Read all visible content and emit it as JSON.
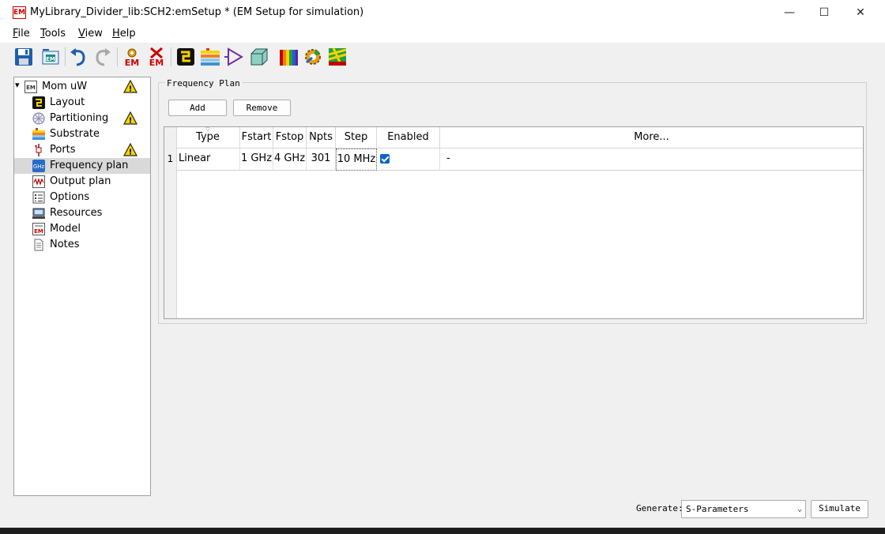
{
  "window": {
    "title": "MyLibrary_Divider_lib:SCH2:emSetup * (EM Setup for simulation)",
    "app_icon_text": "EM",
    "minimize_glyph": "—",
    "maximize_glyph": "☐",
    "close_glyph": "✕"
  },
  "menu": [
    "File",
    "Tools",
    "View",
    "Help"
  ],
  "toolbar": {
    "icons": [
      "save-icon",
      "export-em-icon",
      "undo-icon",
      "redo-icon",
      "em-settings-icon",
      "em-delete-icon",
      "layout-icon",
      "substrate-icon",
      "ports-icon",
      "box-3d-icon",
      "spectrum-icon",
      "simulate-gear-icon",
      "visualize-icon"
    ],
    "em_text": "EM"
  },
  "tree": {
    "root": {
      "label": "Mom uW",
      "icon": "em-icon",
      "warning": true,
      "expand_glyph": "▾"
    },
    "items": [
      {
        "label": "Layout",
        "icon": "layout-icon",
        "warning": false,
        "selected": false
      },
      {
        "label": "Partitioning",
        "icon": "partitioning-icon",
        "warning": true,
        "selected": false
      },
      {
        "label": "Substrate",
        "icon": "substrate-icon",
        "warning": false,
        "selected": false
      },
      {
        "label": "Ports",
        "icon": "ports-icon",
        "warning": true,
        "selected": false
      },
      {
        "label": "Frequency plan",
        "icon": "ghz-icon",
        "warning": false,
        "selected": true
      },
      {
        "label": "Output plan",
        "icon": "output-plan-icon",
        "warning": false,
        "selected": false
      },
      {
        "label": "Options",
        "icon": "options-icon",
        "warning": false,
        "selected": false
      },
      {
        "label": "Resources",
        "icon": "resources-icon",
        "warning": false,
        "selected": false
      },
      {
        "label": "Model",
        "icon": "model-icon",
        "warning": false,
        "selected": false
      },
      {
        "label": "Notes",
        "icon": "notes-icon",
        "warning": false,
        "selected": false
      }
    ],
    "ghz_icon_text": "GHz",
    "model_icon_text": "EM",
    "warning_glyph": "!"
  },
  "frequency_plan": {
    "group_title": "Frequency Plan",
    "add_label": "Add",
    "remove_label": "Remove",
    "sort_arrow": "▽",
    "columns": [
      "Type",
      "Fstart",
      "Fstop",
      "Npts",
      "Step",
      "Enabled",
      "More..."
    ],
    "rows": [
      {
        "num": "1",
        "type": "Linear",
        "fstart": "1 GHz",
        "fstop": "4 GHz",
        "npts": "301",
        "step": "10 MHz",
        "enabled": true,
        "more": "-"
      }
    ]
  },
  "footer": {
    "generate_label": "Generate:",
    "generate_value": "S-Parameters",
    "caret": "⌄",
    "simulate_label": "Simulate"
  },
  "colors": {
    "accent": "#0a64c8",
    "warning": "#f5d300",
    "em_red": "#cc0000"
  }
}
